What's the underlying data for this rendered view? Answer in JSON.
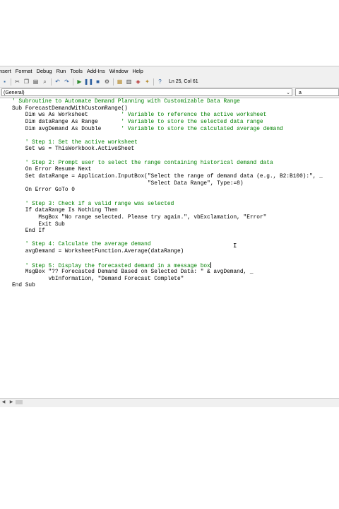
{
  "menu": [
    "nsert",
    "Format",
    "Debug",
    "Run",
    "Tools",
    "Add-Ins",
    "Window",
    "Help"
  ],
  "toolbar": {
    "status": "Ln 25, Col 61",
    "icons": [
      "save-icon",
      "cut-icon",
      "copy-icon",
      "paste-icon",
      "find-icon",
      "undo-icon",
      "redo-icon",
      "run-icon",
      "break-icon",
      "reset-icon",
      "design-mode-icon",
      "project-explorer-icon",
      "properties-icon",
      "object-browser-icon",
      "toolbox-icon",
      "help-icon"
    ]
  },
  "combos": {
    "object": "(General)",
    "procedure": "a"
  },
  "code_lines": [
    [
      {
        "t": "' Subroutine to Automate Demand Planning with Customizable Data Range",
        "c": "cm"
      }
    ],
    [
      {
        "t": "Sub ForecastDemandWithCustomRange()",
        "c": ""
      }
    ],
    [
      {
        "t": "    Dim ws As Worksheet          ",
        "c": ""
      },
      {
        "t": "' Variable to reference the active worksheet",
        "c": "cm"
      }
    ],
    [
      {
        "t": "    Dim dataRange As Range       ",
        "c": ""
      },
      {
        "t": "' Variable to store the selected data range",
        "c": "cm"
      }
    ],
    [
      {
        "t": "    Dim avgDemand As Double      ",
        "c": ""
      },
      {
        "t": "' Variable to store the calculated average demand",
        "c": "cm"
      }
    ],
    [
      {
        "t": "",
        "c": ""
      }
    ],
    [
      {
        "t": "    ' Step 1: Set the active worksheet",
        "c": "cm"
      }
    ],
    [
      {
        "t": "    Set ws = ThisWorkbook.ActiveSheet",
        "c": ""
      }
    ],
    [
      {
        "t": "",
        "c": ""
      }
    ],
    [
      {
        "t": "    ' Step 2: Prompt user to select the range containing historical demand data",
        "c": "cm"
      }
    ],
    [
      {
        "t": "    On Error Resume Next",
        "c": ""
      }
    ],
    [
      {
        "t": "    Set dataRange = Application.InputBox(\"Select the range of demand data (e.g., B2:B100):\", _",
        "c": ""
      }
    ],
    [
      {
        "t": "                                         \"Select Data Range\", Type:=8)",
        "c": ""
      }
    ],
    [
      {
        "t": "    On Error GoTo 0",
        "c": ""
      }
    ],
    [
      {
        "t": "",
        "c": ""
      }
    ],
    [
      {
        "t": "    ' Step 3: Check if a valid range was selected",
        "c": "cm"
      }
    ],
    [
      {
        "t": "    If dataRange Is Nothing Then",
        "c": ""
      }
    ],
    [
      {
        "t": "        MsgBox \"No range selected. Please try again.\", vbExclamation, \"Error\"",
        "c": ""
      }
    ],
    [
      {
        "t": "        Exit Sub",
        "c": ""
      }
    ],
    [
      {
        "t": "    End If",
        "c": ""
      }
    ],
    [
      {
        "t": "",
        "c": ""
      }
    ],
    [
      {
        "t": "    ' Step 4: Calculate the average demand",
        "c": "cm"
      }
    ],
    [
      {
        "t": "    avgDemand = WorksheetFunction.Average(dataRange)",
        "c": ""
      }
    ],
    [
      {
        "t": "",
        "c": ""
      }
    ],
    [
      {
        "t": "    ' Step 5: Display the forecasted demand in a message box",
        "c": "cm"
      }
    ],
    [
      {
        "t": "    MsgBox \"?? Forecasted Demand Based on Selected Data: \" & avgDemand, _",
        "c": ""
      }
    ],
    [
      {
        "t": "           vbInformation, \"Demand Forecast Complete\"",
        "c": ""
      }
    ],
    [
      {
        "t": "End Sub",
        "c": ""
      }
    ]
  ]
}
